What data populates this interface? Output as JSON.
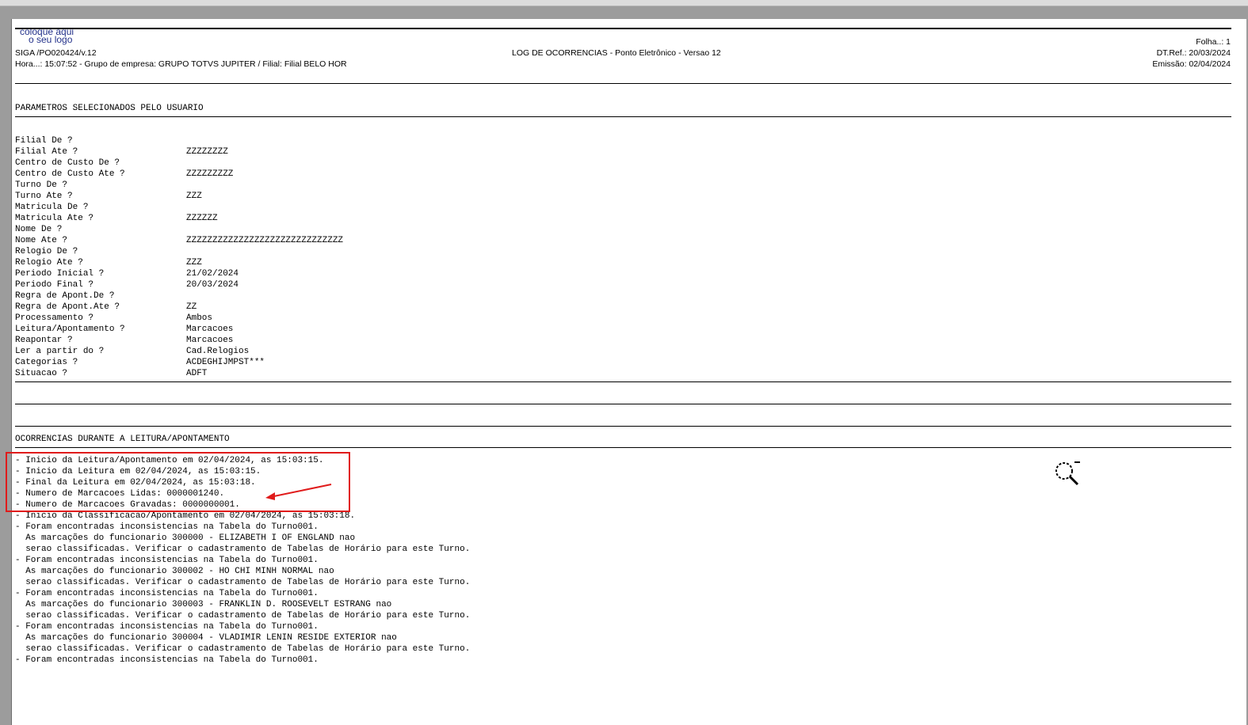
{
  "header": {
    "logo_line1": "coloque aqui",
    "logo_line2": "o seu logo",
    "program": "SIGA /PO020424/v.12",
    "time_group": "Hora...: 15:07:52 - Grupo de empresa: GRUPO TOTVS JUPITER / Filial: Filial BELO HOR",
    "title": "LOG DE OCORRENCIAS - Ponto Eletrônico - Versao 12",
    "folha": "Folha..:     1",
    "dtref": "DT.Ref.: 20/03/2024",
    "emissao": "Emissão: 02/04/2024"
  },
  "params_title": "PARAMETROS SELECIONADOS PELO USUARIO",
  "params": [
    {
      "label": "Filial De ?",
      "value": ""
    },
    {
      "label": "Filial Ate ?",
      "value": "ZZZZZZZZ"
    },
    {
      "label": "Centro de Custo De ?",
      "value": ""
    },
    {
      "label": "Centro de Custo Ate ?",
      "value": "ZZZZZZZZZ"
    },
    {
      "label": "Turno De ?",
      "value": ""
    },
    {
      "label": "Turno Ate ?",
      "value": "ZZZ"
    },
    {
      "label": "Matricula De ?",
      "value": ""
    },
    {
      "label": "Matricula Ate ?",
      "value": "ZZZZZZ"
    },
    {
      "label": "Nome De ?",
      "value": ""
    },
    {
      "label": "Nome Ate ?",
      "value": "ZZZZZZZZZZZZZZZZZZZZZZZZZZZZZZ"
    },
    {
      "label": "Relogio De ?",
      "value": ""
    },
    {
      "label": "Relogio Ate ?",
      "value": "ZZZ"
    },
    {
      "label": "Periodo Inicial ?",
      "value": "21/02/2024"
    },
    {
      "label": "Periodo Final ?",
      "value": "20/03/2024"
    },
    {
      "label": "Regra de Apont.De ?",
      "value": ""
    },
    {
      "label": "Regra de Apont.Ate ?",
      "value": "ZZ"
    },
    {
      "label": "Processamento ?",
      "value": "Ambos"
    },
    {
      "label": "Leitura/Apontamento ?",
      "value": "Marcacoes"
    },
    {
      "label": "Reapontar ?",
      "value": "Marcacoes"
    },
    {
      "label": "Ler a partir do ?",
      "value": "Cad.Relogios"
    },
    {
      "label": "Categorias ?",
      "value": "ACDEGHIJMPST***"
    },
    {
      "label": "Situacao ?",
      "value": "ADFT"
    }
  ],
  "occ_title": "OCORRENCIAS DURANTE A LEITURA/APONTAMENTO",
  "occurrences": [
    "- Inicio da Leitura/Apontamento em 02/04/2024, as 15:03:15.",
    "- Inicio da Leitura em 02/04/2024, as 15:03:15.",
    "- Final da Leitura em 02/04/2024, as 15:03:18.",
    "- Numero de Marcacoes Lidas: 0000001240.",
    "- Numero de Marcacoes Gravadas: 0000000001.",
    "- Inicio da Classificacao/Apontamento em 02/04/2024, as 15:03:18.",
    "- Foram encontradas inconsistencias na Tabela do Turno001.",
    "  As marcações do funcionario 300000 - ELIZABETH I OF ENGLAND nao",
    "  serao classificadas. Verificar o cadastramento de Tabelas de Horário para este Turno.",
    "- Foram encontradas inconsistencias na Tabela do Turno001.",
    "  As marcações do funcionario 300002 - HO CHI MINH NORMAL nao",
    "  serao classificadas. Verificar o cadastramento de Tabelas de Horário para este Turno.",
    "- Foram encontradas inconsistencias na Tabela do Turno001.",
    "  As marcações do funcionario 300003 - FRANKLIN D. ROOSEVELT ESTRANG nao",
    "  serao classificadas. Verificar o cadastramento de Tabelas de Horário para este Turno.",
    "- Foram encontradas inconsistencias na Tabela do Turno001.",
    "  As marcações do funcionario 300004 - VLADIMIR LENIN RESIDE EXTERIOR nao",
    "  serao classificadas. Verificar o cadastramento de Tabelas de Horário para este Turno.",
    "- Foram encontradas inconsistencias na Tabela do Turno001."
  ],
  "colors": {
    "annotation": "#e01b1b",
    "logo": "#23318a"
  },
  "icons": {
    "zoom": "zoom-cursor-icon"
  }
}
